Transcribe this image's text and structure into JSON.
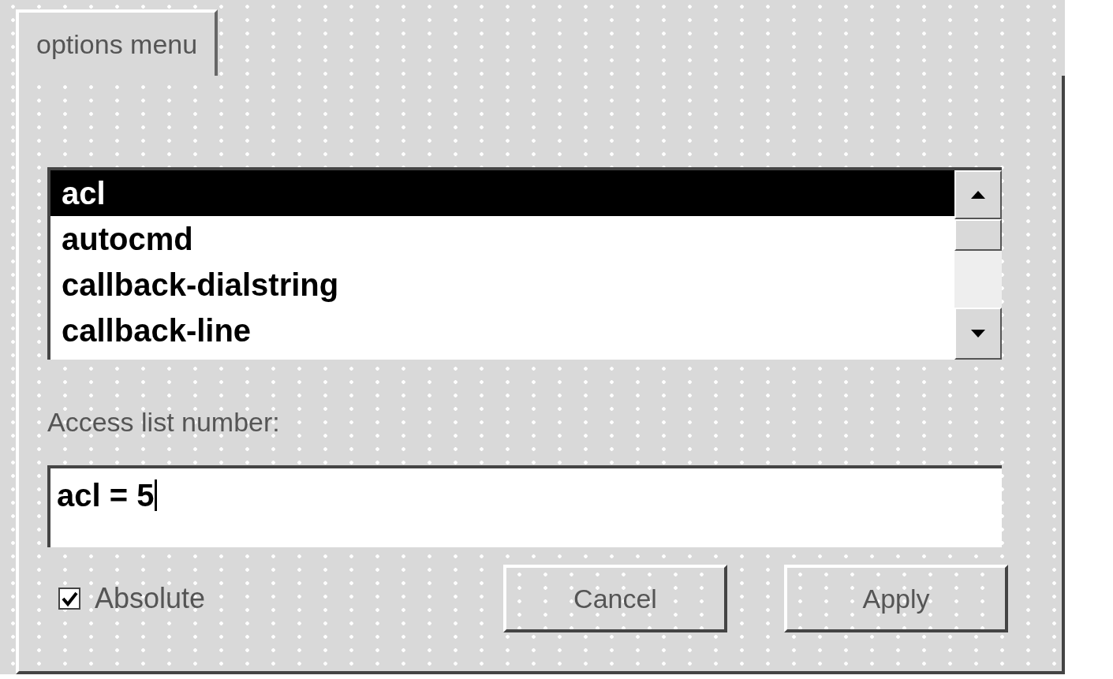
{
  "tabs": [
    {
      "label": "options menu",
      "selected": true
    }
  ],
  "list": {
    "items": [
      {
        "label": "acl",
        "selected": true
      },
      {
        "label": "autocmd",
        "selected": false
      },
      {
        "label": "callback-dialstring",
        "selected": false
      },
      {
        "label": "callback-line",
        "selected": false
      }
    ]
  },
  "field": {
    "label": "Access list number:",
    "value": "acl = 5"
  },
  "checkbox": {
    "label": "Absolute",
    "checked": true
  },
  "buttons": [
    "Cancel",
    "Apply"
  ]
}
